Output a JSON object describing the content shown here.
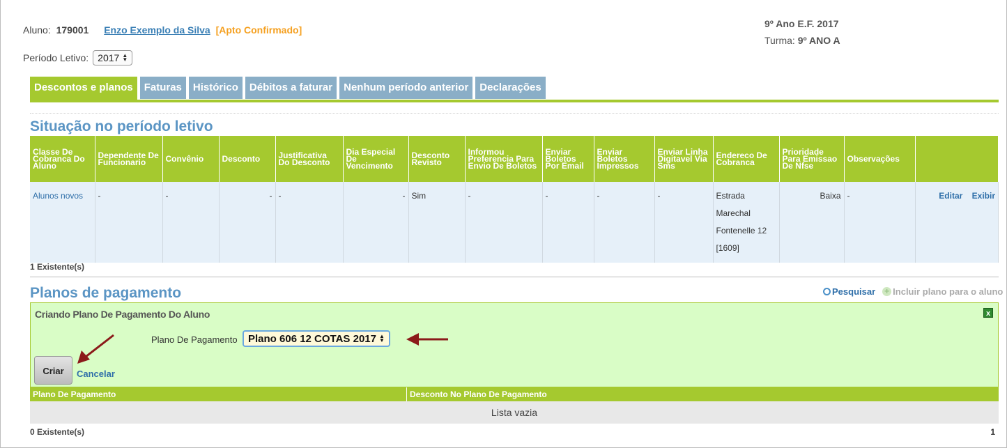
{
  "student": {
    "label": "Aluno:",
    "number": "179001",
    "name": "Enzo Exemplo da Silva",
    "status": "[Apto Confirmado]"
  },
  "class_info": {
    "grade": "9º Ano E.F. 2017",
    "turma_label": "Turma:",
    "turma_value": "9º ANO A"
  },
  "periodo": {
    "label": "Período Letivo:",
    "selected": "2017"
  },
  "tabs": [
    {
      "label": "Descontos e planos",
      "active": true
    },
    {
      "label": "Faturas"
    },
    {
      "label": "Histórico"
    },
    {
      "label": "Débitos a faturar"
    },
    {
      "label": "Nenhum período anterior"
    },
    {
      "label": "Declarações"
    }
  ],
  "situacao": {
    "title": "Situação no período letivo",
    "headers": [
      "Classe De Cobranca Do Aluno",
      "Dependente De Funcionario",
      "Convênio",
      "Desconto",
      "Justificativa Do Desconto",
      "Dia Especial De Vencimento",
      "Desconto Revisto",
      "Informou Preferencia Para Envio De Boletos",
      "Enviar Boletos Por Email",
      "Enviar Boletos Impressos",
      "Enviar Linha Digitavel Via Sms",
      "Endereco De Cobranca",
      "Prioridade Para Emissao De Nfse",
      "Observações",
      ""
    ],
    "row": {
      "classe": "Alunos novos",
      "dependente": "-",
      "convenio": "-",
      "desconto": "-",
      "justificativa": "-",
      "dia_especial": "-",
      "desconto_revisto": "Sim",
      "informou_pref": "-",
      "enviar_email": "-",
      "enviar_impressos": "-",
      "enviar_sms": "-",
      "endereco": "Estrada Marechal Fontenelle 12 [1609]",
      "prioridade": "Baixa",
      "observacoes": "-",
      "editar": "Editar",
      "exibir": "Exibir"
    },
    "count": "1 Existente(s)"
  },
  "planos": {
    "title": "Planos de pagamento",
    "pesquisar": "Pesquisar",
    "incluir": "Incluir plano para o aluno",
    "panel_title": "Criando Plano De Pagamento Do Aluno",
    "close": "x",
    "field_label": "Plano De Pagamento",
    "field_value": "Plano 606 12 COTAS 2017",
    "criar": "Criar",
    "cancelar": "Cancelar",
    "col1": "Plano De Pagamento",
    "col2": "Desconto No Plano De Pagamento",
    "empty": "Lista vazia",
    "count": "0 Existente(s)",
    "page": "1"
  },
  "colors": {
    "green": "#a5c92f",
    "tab_blue": "#8aaec7",
    "title_blue": "#5b95c4",
    "link_blue": "#2f6fa9",
    "orange": "#f5a020",
    "arrow": "#8b1a1a"
  }
}
